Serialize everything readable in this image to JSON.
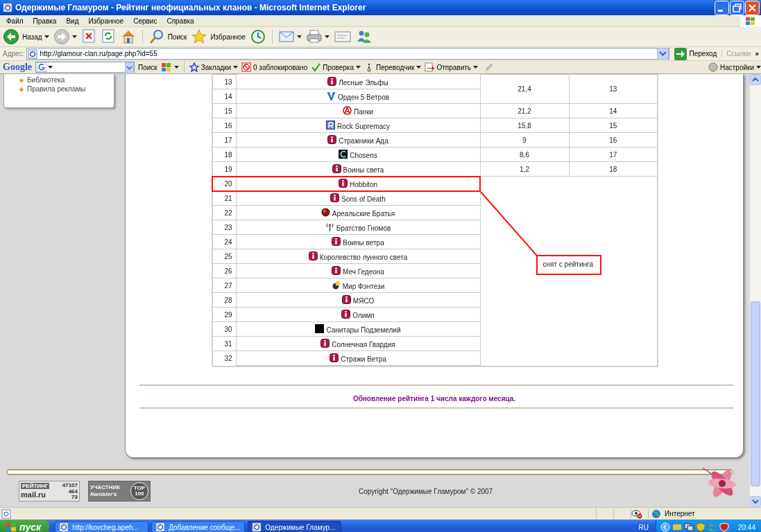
{
  "window": {
    "title": "Одержимые Гламуром - Рейтинг неофициальных кланов - Microsoft Internet Explorer"
  },
  "menu": [
    "Файл",
    "Правка",
    "Вид",
    "Избранное",
    "Сервис",
    "Справка"
  ],
  "toolbar": [
    {
      "kind": "back",
      "label": "Назад",
      "dropdown": true
    },
    {
      "kind": "forward",
      "dropdown": true
    },
    {
      "kind": "stop",
      "dropdown": false
    },
    {
      "kind": "refresh",
      "dropdown": false
    },
    {
      "kind": "home",
      "dropdown": false
    },
    {
      "kind": "search",
      "label": "Поиск",
      "dropdown": false
    },
    {
      "kind": "favorites",
      "label": "Избранное",
      "dropdown": false
    },
    {
      "kind": "history",
      "dropdown": false
    },
    {
      "kind": "mail",
      "dropdown": true
    },
    {
      "kind": "print",
      "dropdown": true
    },
    {
      "kind": "edit",
      "dropdown": false
    },
    {
      "kind": "messenger",
      "dropdown": false
    }
  ],
  "address": {
    "label": "Адрес:",
    "url": "http://glamour-clan.ru/page.php?id=55",
    "go": "Переход",
    "links": "Ссылки",
    "more": "»"
  },
  "google_bar": {
    "logo": "Google",
    "search": "Поиск",
    "items": [
      {
        "kind": "bookmarks",
        "label": "Закладки",
        "dropdown": true
      },
      {
        "kind": "blocked",
        "label": "0 заблокировано",
        "dropdown": false
      },
      {
        "kind": "spell",
        "label": "Проверка",
        "dropdown": true
      },
      {
        "kind": "translate",
        "label": "Переводчик",
        "dropdown": true
      },
      {
        "kind": "send",
        "label": "Отправить",
        "dropdown": true
      }
    ],
    "settings": "Настройки"
  },
  "sidebar": {
    "items": [
      "Библиотека",
      "Правила рекламы"
    ]
  },
  "ranking": {
    "groups": [
      {
        "score": "21,4",
        "place": "13",
        "clans": [
          {
            "rank": "13",
            "name": "Лесные Эльфы",
            "kind": "info",
            "highlighted": false
          },
          {
            "rank": "14",
            "name": "Орден 5 Ветров",
            "kind": "vee",
            "highlighted": false
          }
        ]
      },
      {
        "score": "21,2",
        "place": "14",
        "clans": [
          {
            "rank": "15",
            "name": "Панки",
            "kind": "anarchy",
            "highlighted": false
          }
        ]
      },
      {
        "score": "15,8",
        "place": "15",
        "clans": [
          {
            "rank": "16",
            "name": "Rock Supremacy",
            "kind": "emblem",
            "highlighted": false
          }
        ]
      },
      {
        "score": "9",
        "place": "16",
        "clans": [
          {
            "rank": "17",
            "name": "Стражники Ада",
            "kind": "info",
            "highlighted": false
          }
        ]
      },
      {
        "score": "8,6",
        "place": "17",
        "clans": [
          {
            "rank": "18",
            "name": "Chosens",
            "kind": "arc",
            "highlighted": false
          }
        ]
      },
      {
        "score": "1,2",
        "place": "18",
        "clans": [
          {
            "rank": "19",
            "name": "Воины света",
            "kind": "info",
            "highlighted": false
          }
        ]
      },
      {
        "note": "снят с рейтинга",
        "clans": [
          {
            "rank": "20",
            "name": "Hobbiton",
            "kind": "info",
            "highlighted": true
          },
          {
            "rank": "21",
            "name": "Sons of Death",
            "kind": "info",
            "highlighted": false
          },
          {
            "rank": "22",
            "name": "Ареальские Братья",
            "kind": "ball",
            "highlighted": false
          },
          {
            "rank": "23",
            "name": "Братство Гномов",
            "kind": "antenna",
            "highlighted": false
          },
          {
            "rank": "24",
            "name": "Воины ветра",
            "kind": "info",
            "highlighted": false
          },
          {
            "rank": "25",
            "name": "Королевство лунного света",
            "kind": "info",
            "highlighted": false
          },
          {
            "rank": "26",
            "name": "Меч Гедеона",
            "kind": "info",
            "highlighted": false
          },
          {
            "rank": "27",
            "name": "Мир Фэнтези",
            "kind": "bomb",
            "highlighted": false
          },
          {
            "rank": "28",
            "name": "МЯСО",
            "kind": "info",
            "highlighted": false
          },
          {
            "rank": "29",
            "name": "Олимп",
            "kind": "info",
            "highlighted": false
          },
          {
            "rank": "30",
            "name": "Санитары Подземелий",
            "kind": "square",
            "highlighted": false
          },
          {
            "rank": "31",
            "name": "Солнечная Гвардия",
            "kind": "info",
            "highlighted": false
          },
          {
            "rank": "32",
            "name": "Стражи Ветра",
            "kind": "info",
            "highlighted": false
          }
        ]
      }
    ],
    "update_note": "Обновление рейтинга 1 числа каждого месяца."
  },
  "footer": {
    "mail_counter": {
      "label": "РЕЙТИНГ",
      "total": "47107",
      "today": "464",
      "online": "73",
      "brand": "mail.ru"
    },
    "rambler_counter": {
      "label": "УЧАСТНИК",
      "brand": "Rambler's",
      "top": "TOP",
      "rank": "100"
    },
    "copyright": "Copyright \"Одержимые Гламуром\" © 2007"
  },
  "status_bar": {
    "zone": "Интернет"
  },
  "taskbar": {
    "start": "пуск",
    "tasks": [
      {
        "label": "http://kovcheg.apeh...",
        "selected": false
      },
      {
        "label": "Добавление сообще...",
        "selected": false
      },
      {
        "label": "Одержимые Гламур...",
        "selected": true
      }
    ],
    "lang": "RU",
    "clock": "20:44"
  }
}
